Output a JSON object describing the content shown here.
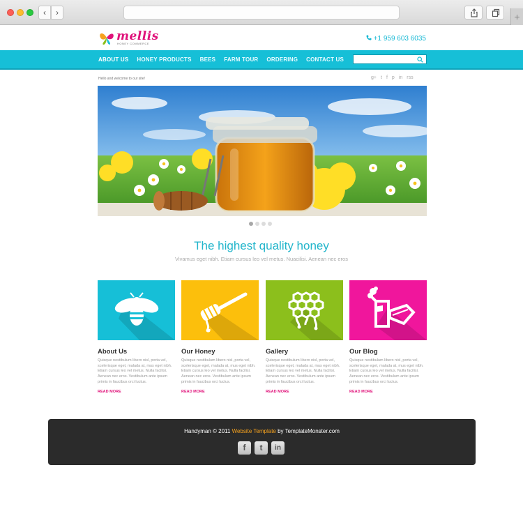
{
  "browser": {
    "back_glyph": "‹",
    "forward_glyph": "›",
    "new_tab_glyph": "+",
    "icons": [
      "share-icon",
      "tabs-icon"
    ]
  },
  "header": {
    "logo_text": "mellis",
    "logo_tagline": "HONEY COMMERCE",
    "phone": "+1 959 603 6035",
    "accent_color": "#16bfd7",
    "brand_color": "#e0127a"
  },
  "nav": {
    "items": [
      {
        "label": "ABOUT US",
        "active": true
      },
      {
        "label": "HONEY PRODUCTS",
        "active": false
      },
      {
        "label": "BEES",
        "active": false
      },
      {
        "label": "FARM TOUR",
        "active": false
      },
      {
        "label": "ORDERING",
        "active": false
      },
      {
        "label": "CONTACT US",
        "active": false
      }
    ],
    "search_placeholder": ""
  },
  "welcome_text": "Hello and welcome to our site!",
  "social_icons": [
    "google-plus-icon",
    "twitter-icon",
    "facebook-icon",
    "pinterest-icon",
    "linkedin-icon",
    "rss-icon"
  ],
  "social_glyphs": [
    "g+",
    "t",
    "f",
    "p",
    "in",
    "rss"
  ],
  "slider": {
    "dot_count": 4,
    "active_index": 0
  },
  "intro": {
    "headline": "The highest quality honey",
    "tagline": "Vivamus eget nibh. Etiam cursus leo vel metus. Nuacilisi. Aenean nec eros"
  },
  "features": [
    {
      "title": "About Us",
      "icon": "bee-icon",
      "color": "#16bfd7",
      "text": "Quisque nestibulum libero nisl, porta vel, scelerisque eget, malada at, mus eget nibh. Etiam cursus leo vel metus. Nulla facilisi. Aenean nec eros. Vestibulum ante ipsum primis in faucibus orci luctus.",
      "link": "READ MORE"
    },
    {
      "title": "Our Honey",
      "icon": "honey-dipper-icon",
      "color": "#fcbf0c",
      "text": "Quisque nestibulum libero nisl, porta vel, scelerisque eget, malada at, mus eget nibh. Etiam cursus leo vel metus. Nulla facilisi. Aenean nec eros. Vestibulum ante ipsum primis in faucibus orci luctus.",
      "link": "READ MORE"
    },
    {
      "title": "Gallery",
      "icon": "honeycomb-icon",
      "color": "#8cbf1c",
      "text": "Quisque nestibulum libero nisl, porta vel, scelerisque eget, malada at, mus eget nibh. Etiam cursus leo vel metus. Nulla facilisi. Aenean nec eros. Vestibulum ante ipsum primis in faucibus orci luctus.",
      "link": "READ MORE"
    },
    {
      "title": "Our Blog",
      "icon": "bee-smoker-icon",
      "color": "#f0169c",
      "text": "Quisque nestibulum libero nisl, porta vel, scelerisque eget, malada at, mus eget nibh. Etiam cursus leo vel metus. Nulla facilisi. Aenean nec eros. Vestibulum ante ipsum primis in faucibus orci luctus.",
      "link": "READ MORE"
    }
  ],
  "footer": {
    "prefix": "Handyman © 2011",
    "link_text": "Website Template",
    "suffix": "by TemplateMonster.com",
    "social": [
      {
        "icon": "facebook-icon",
        "glyph": "f"
      },
      {
        "icon": "twitter-icon",
        "glyph": "t"
      },
      {
        "icon": "linkedin-icon",
        "glyph": "in"
      }
    ]
  }
}
